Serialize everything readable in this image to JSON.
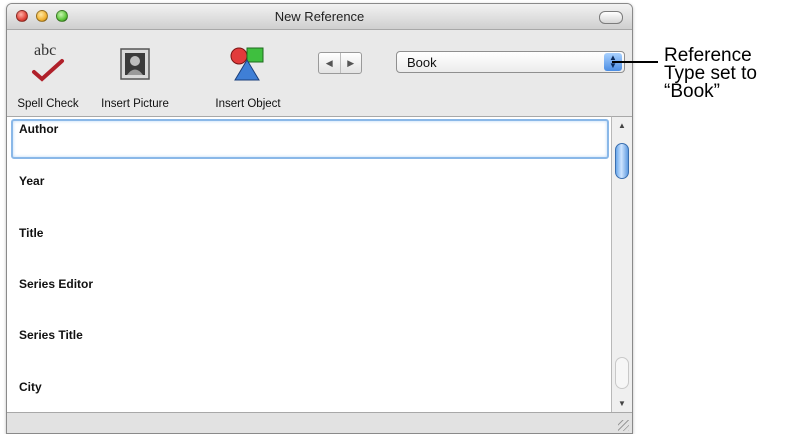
{
  "window": {
    "title": "New Reference"
  },
  "toolbar": {
    "spell_check": {
      "label": "Spell Check",
      "glyph": "abc"
    },
    "insert_picture": {
      "label": "Insert Picture"
    },
    "insert_object": {
      "label": "Insert Object"
    },
    "prev_arrow": "◀",
    "next_arrow": "▶",
    "reference_type": "Book",
    "stepper_up": "▲",
    "stepper_down": "▼"
  },
  "fields": [
    {
      "name": "Author"
    },
    {
      "name": "Year"
    },
    {
      "name": "Title"
    },
    {
      "name": "Series Editor"
    },
    {
      "name": "Series Title"
    },
    {
      "name": "City"
    }
  ],
  "scrollbar": {
    "up": "▲",
    "down": "▼"
  },
  "annotation": {
    "line1": "Reference",
    "line2": "Type set to",
    "line3": "“Book”"
  },
  "colors": {
    "focus_ring": "#8ab8e8",
    "popup_stepper": "#4b8de3"
  }
}
